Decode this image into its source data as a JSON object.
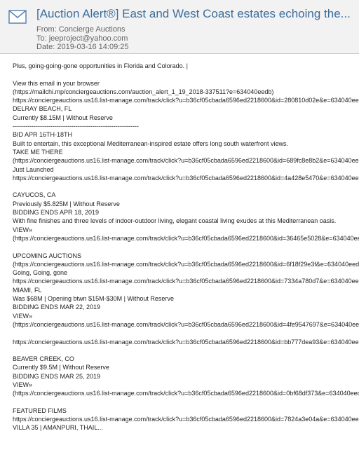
{
  "header": {
    "subject": "[Auction Alert®]  East and West Coast estates echoing the...",
    "from": "From: Concierge Auctions",
    "to": "To: jeeproject@yahoo.com",
    "date": "Date: 2019-03-16 14:09:25"
  },
  "body_lines": [
    "Plus, going-going-gone opportunities in Florida and Colorado. |",
    "",
    "View this email in your browser",
    "(https://mailchi.mp/conciergeauctions.com/auction_alert_1_19_2018-337511?e=634040eedb)",
    "https://conciergeauctions.us16.list-manage.com/track/click?u=b36cf05cbada6596ed2218600&id=280810d02e&e=634040eedb",
    "DELRAY BEACH, FL",
    "Currently $8.15M | Without Reserve",
    "------------------------------------------------------------",
    "BID APR 16TH-18TH",
    "Built to entertain, this exceptional Mediterranean-inspired estate offers long south waterfront views.",
    "TAKE ME THERE",
    "(https://conciergeauctions.us16.list-manage.com/track/click?u=b36cf05cbada6596ed2218600&id=689fc8e8b2&e=634040eedb)",
    "Just Launched",
    "https://conciergeauctions.us16.list-manage.com/track/click?u=b36cf05cbada6596ed2218600&id=4a428e5470&e=634040eedb",
    "",
    "CAYUCOS, CA",
    "Previously $5.825M | Without Reserve",
    "BIDDING ENDS APR 18, 2019",
    "With fine finishes and three levels of indoor-outdoor living, elegant coastal living exudes at this Mediterranean oasis.",
    "VIEW»",
    "(https://conciergeauctions.us16.list-manage.com/track/click?u=b36cf05cbada6596ed2218600&id=36465e5028&e=634040eedb)",
    "",
    "UPCOMING AUCTIONS",
    "(https://conciergeauctions.us16.list-manage.com/track/click?u=b36cf05cbada6596ed2218600&id=6f18f29e3f&e=634040eedb)",
    "Going, Going, gone",
    "https://conciergeauctions.us16.list-manage.com/track/click?u=b36cf05cbada6596ed2218600&id=7334a780d7&e=634040eedb",
    "MIAMI, FL",
    "Was $68M | Opening btwn $15M-$30M | Without Reserve",
    "BIDDING ENDS MAR 22, 2019",
    "VIEW»",
    "(https://conciergeauctions.us16.list-manage.com/track/click?u=b36cf05cbada6596ed2218600&id=4fe9547697&e=634040eedb)",
    "",
    "https://conciergeauctions.us16.list-manage.com/track/click?u=b36cf05cbada6596ed2218600&id=bb777dea93&e=634040eedb",
    "",
    "BEAVER CREEK, CO",
    "Currently $9.5M | Without Reserve",
    "BIDDING ENDS MAR 25, 2019",
    "VIEW»",
    "(https://conciergeauctions.us16.list-manage.com/track/click?u=b36cf05cbada6596ed2218600&id=0bf68df373&e=634040eedb)",
    "",
    "FEATURED FILMS",
    "https://conciergeauctions.us16.list-manage.com/track/click?u=b36cf05cbada6596ed2218600&id=7824a3e04a&e=634040eedb",
    "VILLA 35 | AMANPURI, THAIL..."
  ]
}
